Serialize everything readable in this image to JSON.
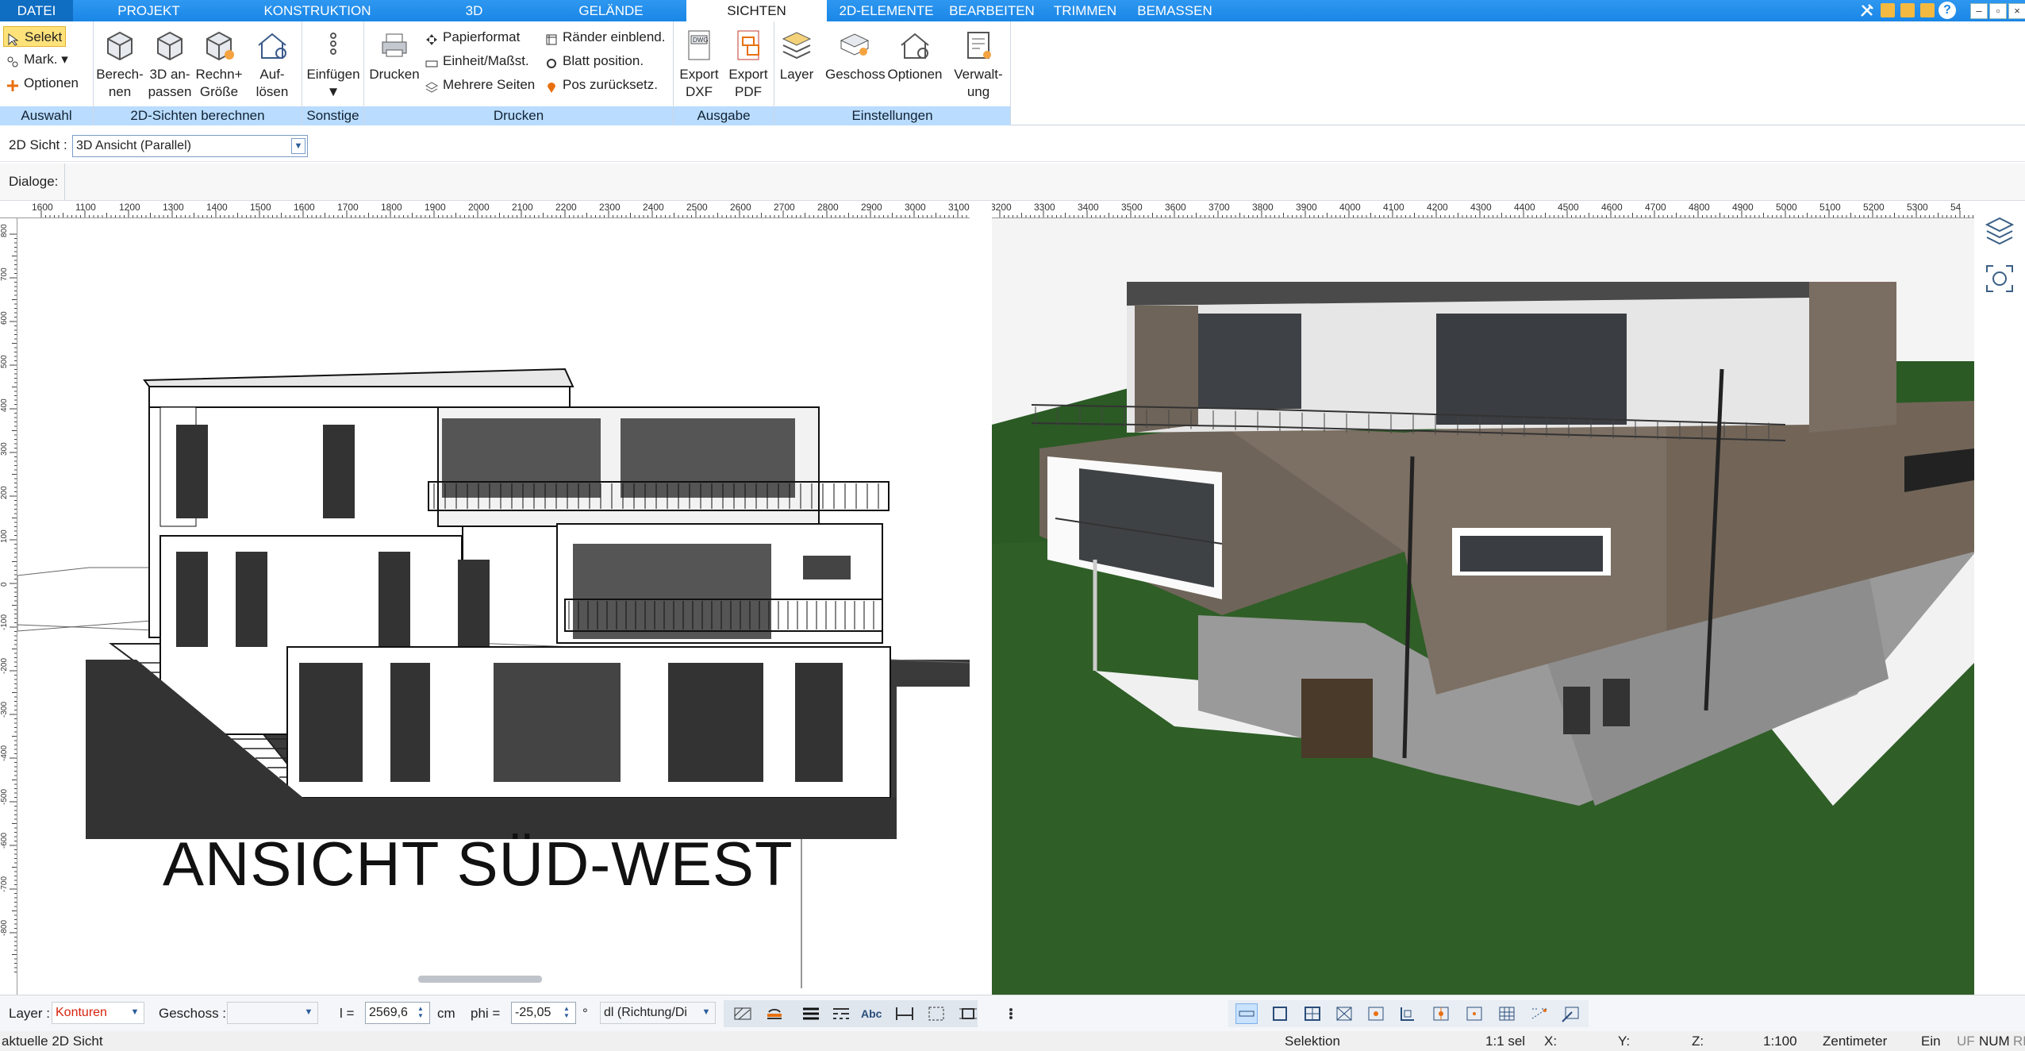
{
  "menu": {
    "tabs": [
      "DATEI",
      "PROJEKT",
      "KONSTRUKTION",
      "3D",
      "GELÄNDE",
      "SICHTEN",
      "2D-ELEMENTE",
      "BEARBEITEN",
      "TRIMMEN",
      "BEMASSEN"
    ],
    "active": "SICHTEN"
  },
  "ribbon": {
    "auswahl": {
      "label": "Auswahl",
      "selekt": "Selekt",
      "mark": "Mark.",
      "optionen": "Optionen"
    },
    "sichten2d": {
      "label": "2D-Sichten berechnen",
      "berechnen": [
        "Berech-",
        "nen"
      ],
      "anpassen": [
        "3D an-",
        "passen"
      ],
      "rechn": [
        "Rechn+",
        "Größe"
      ],
      "aufloesen": [
        "Auf-",
        "lösen"
      ]
    },
    "sonstige": {
      "label": "Sonstige",
      "einfuegen": "Einfügen"
    },
    "drucken": {
      "label": "Drucken",
      "drucken": "Drucken",
      "papierformat": "Papierformat",
      "einheit": "Einheit/Maßst.",
      "mehrere": "Mehrere Seiten",
      "raender": "Ränder einblend.",
      "blatt": "Blatt position.",
      "pos": "Pos zurücksetz."
    },
    "ausgabe": {
      "label": "Ausgabe",
      "dxf": [
        "Export",
        "DXF"
      ],
      "pdf": [
        "Export",
        "PDF"
      ]
    },
    "einstellungen": {
      "label": "Einstellungen",
      "layer": "Layer",
      "geschoss": "Geschoss",
      "optionen": "Optionen",
      "verwaltung": [
        "Verwalt-",
        "ung"
      ]
    }
  },
  "view2d": {
    "label": "2D Sicht :",
    "value": "3D Ansicht (Parallel)"
  },
  "dialoge": {
    "label": "Dialoge:"
  },
  "left_panel": {
    "caption": "ANSICHT SÜD-WEST",
    "ruler_top": [
      "1600",
      "1100",
      "1200",
      "1300",
      "1400",
      "1500",
      "1600",
      "1700",
      "1800",
      "1900",
      "2000",
      "2100",
      "2200",
      "2300",
      "2400",
      "2500",
      "2600",
      "2700",
      "2800",
      "2900",
      "3000",
      "3100"
    ],
    "ruler_left": [
      "800",
      "700",
      "600",
      "500",
      "400",
      "300",
      "200",
      "100",
      "0",
      "-100",
      "-200",
      "-300",
      "-400",
      "-500",
      "-600",
      "-700",
      "-800"
    ]
  },
  "right_panel": {
    "ruler_top": [
      "3200",
      "3300",
      "3400",
      "3500",
      "3600",
      "3700",
      "3800",
      "3900",
      "4000",
      "4100",
      "4200",
      "4300",
      "4400",
      "4500",
      "4600",
      "4700",
      "4800",
      "4900",
      "5000",
      "5100",
      "5200",
      "5300",
      "54"
    ]
  },
  "bottom_toolbar": {
    "layer_label": "Layer :",
    "layer_value": "Konturen",
    "geschoss_label": "Geschoss :",
    "geschoss_value": "",
    "l_label": "l =",
    "l_value": "2569,6",
    "l_unit": "cm",
    "phi_label": "phi =",
    "phi_value": "-25,05",
    "phi_unit": "°",
    "dl_value": "dl (Richtung/Di",
    "abc": "Abc",
    "colors": {
      "layer_value": "#d9230f",
      "accent": "#1a86e6"
    }
  },
  "status": {
    "left": "aktuelle 2D Sicht",
    "mode": "Selektion",
    "sel": "1:1 sel",
    "x": "X:",
    "y": "Y:",
    "z": "Z:",
    "scale": "1:100",
    "unit": "Zentimeter",
    "ein": "Ein",
    "uf": "UF",
    "num": "NUM",
    "rf": "RF"
  }
}
